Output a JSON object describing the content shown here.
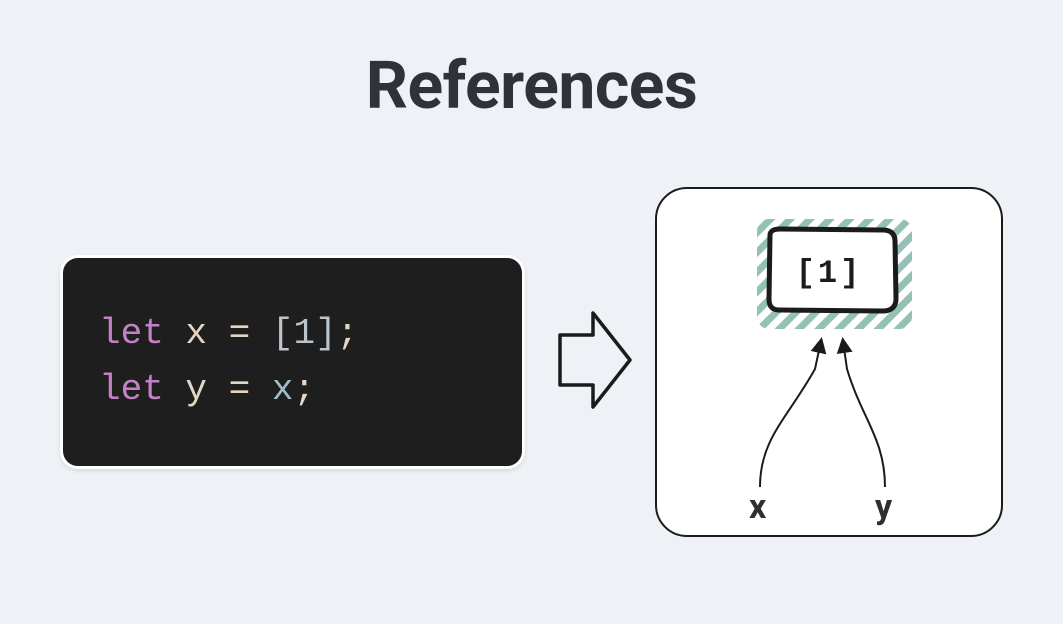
{
  "title": "References",
  "code": {
    "line1": {
      "keyword": "let",
      "variable": "x",
      "equals": "=",
      "literal": "[1]",
      "semicolon": ";"
    },
    "line2": {
      "keyword": "let",
      "variable": "y",
      "equals": "=",
      "reference": "x",
      "semicolon": ";"
    }
  },
  "memory": {
    "box_content": "[1]",
    "var_x": "x",
    "var_y": "y"
  },
  "colors": {
    "background": "#eef1f6",
    "code_bg": "#1f1e1e",
    "keyword": "#c481c4",
    "default_text": "#e5d6c4",
    "literal": "#bcc4cb",
    "reference": "#a0bcc7",
    "hatch": "#94c0b5",
    "title": "#2f3238",
    "panel_bg": "#ffffff",
    "stroke": "#1b1b1b"
  }
}
